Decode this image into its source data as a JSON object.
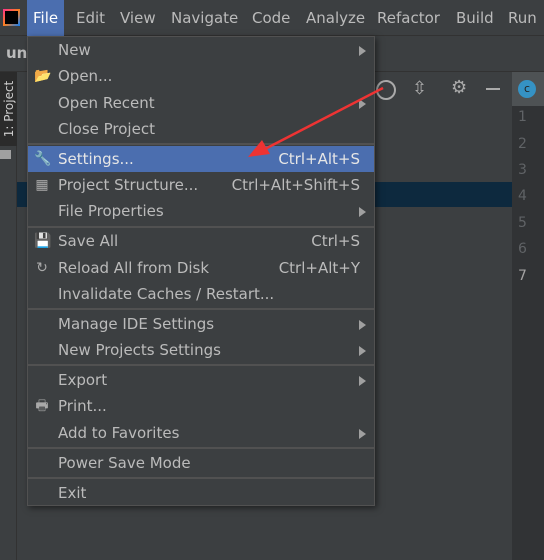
{
  "menubar": {
    "items": [
      "File",
      "Edit",
      "View",
      "Navigate",
      "Code",
      "Analyze",
      "Refactor",
      "Build",
      "Run"
    ],
    "active": "File"
  },
  "navbar": {
    "project_name": "unt"
  },
  "toolstrip": {
    "project_tab": "1: Project"
  },
  "editor": {
    "tab_icon": "c",
    "line_numbers": [
      "1",
      "2",
      "3",
      "4",
      "5",
      "6",
      "7"
    ]
  },
  "file_menu": {
    "items": [
      {
        "label": "New",
        "submenu": true
      },
      {
        "label": "Open...",
        "icon": "folder-open-icon"
      },
      {
        "label": "Open Recent",
        "submenu": true
      },
      {
        "label": "Close Project"
      },
      {
        "label": "Settings...",
        "shortcut": "Ctrl+Alt+S",
        "icon": "wrench-icon",
        "highlighted": true
      },
      {
        "label": "Project Structure...",
        "shortcut": "Ctrl+Alt+Shift+S",
        "icon": "project-structure-icon"
      },
      {
        "label": "File Properties",
        "submenu": true
      },
      {
        "label": "Save All",
        "shortcut": "Ctrl+S",
        "icon": "save-icon"
      },
      {
        "label": "Reload All from Disk",
        "shortcut": "Ctrl+Alt+Y",
        "icon": "reload-icon"
      },
      {
        "label": "Invalidate Caches / Restart..."
      },
      {
        "label": "Manage IDE Settings",
        "submenu": true
      },
      {
        "label": "New Projects Settings",
        "submenu": true
      },
      {
        "label": "Export",
        "submenu": true
      },
      {
        "label": "Print...",
        "icon": "print-icon"
      },
      {
        "label": "Add to Favorites",
        "submenu": true
      },
      {
        "label": "Power Save Mode"
      },
      {
        "label": "Exit"
      }
    ]
  },
  "colors": {
    "highlight": "#4b6eaf",
    "annotation_arrow": "#ee3333"
  }
}
